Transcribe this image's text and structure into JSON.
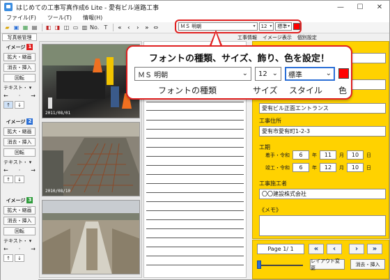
{
  "window": {
    "title": "はじめての工事写真作成6 Lite - 愛有ビル道路工事"
  },
  "window_controls": {
    "minimize": "—",
    "maximize": "☐",
    "close": "✕"
  },
  "menu": {
    "items": [
      "ファイル(F)",
      "ツール(T)",
      "情報(H)"
    ]
  },
  "toolbar": {
    "number_label": "No.",
    "font_name": "ＭＳ 明朝",
    "font_size": "12",
    "font_style": "標準",
    "font_color": "#ff0000"
  },
  "left_panel": {
    "tab": "写真帳管理",
    "groups": [
      {
        "label": "イメージ",
        "num": "1",
        "buttons": [
          "拡大・縮画",
          "消去・挿入",
          "回転"
        ],
        "text_label": "テキスト・"
      },
      {
        "label": "イメージ",
        "num": "2",
        "buttons": [
          "拡大・縮画",
          "消去・挿入",
          "回転"
        ],
        "text_label": "テキスト・"
      },
      {
        "label": "イメージ",
        "num": "3",
        "buttons": [
          "拡大・縮画",
          "消去・挿入",
          "回転"
        ],
        "text_label": "テキスト・"
      }
    ]
  },
  "photos": [
    {
      "date": "2011/08/01"
    },
    {
      "date": "2010/08/10"
    },
    {
      "date": ""
    }
  ],
  "info_tabs": [
    "工事情報",
    "イメージ表示",
    "個別設定"
  ],
  "info_panel": {
    "building": "愛有ビル正面エントランス",
    "address_label": "工事住所",
    "address": "愛有市愛有町1-2-3",
    "period_label": "工期",
    "start_label": "着手",
    "end_label": "竣工",
    "era": "・令和",
    "start": {
      "year": "6",
      "month": "11",
      "day": "10"
    },
    "end": {
      "year": "6",
      "month": "12",
      "day": "10"
    },
    "unit_year": "年",
    "unit_month": "月",
    "unit_day": "日",
    "contractor_label": "工事施工者",
    "contractor": "〇〇建設株式会社",
    "memo_label": "《メモ》"
  },
  "nav": {
    "page": "Page 1/ 1",
    "layout_button": "レイアウト変更",
    "insert_button": "消去・挿入"
  },
  "callout": {
    "title": "フォントの種類、サイズ、飾り、色を設定！",
    "font_name": "ＭＳ 明朝",
    "font_size": "12",
    "font_style": "標準",
    "color": "#ff0000",
    "label_font": "フォントの種類",
    "label_size": "サイズ",
    "label_style": "スタイル",
    "label_color": "色"
  }
}
